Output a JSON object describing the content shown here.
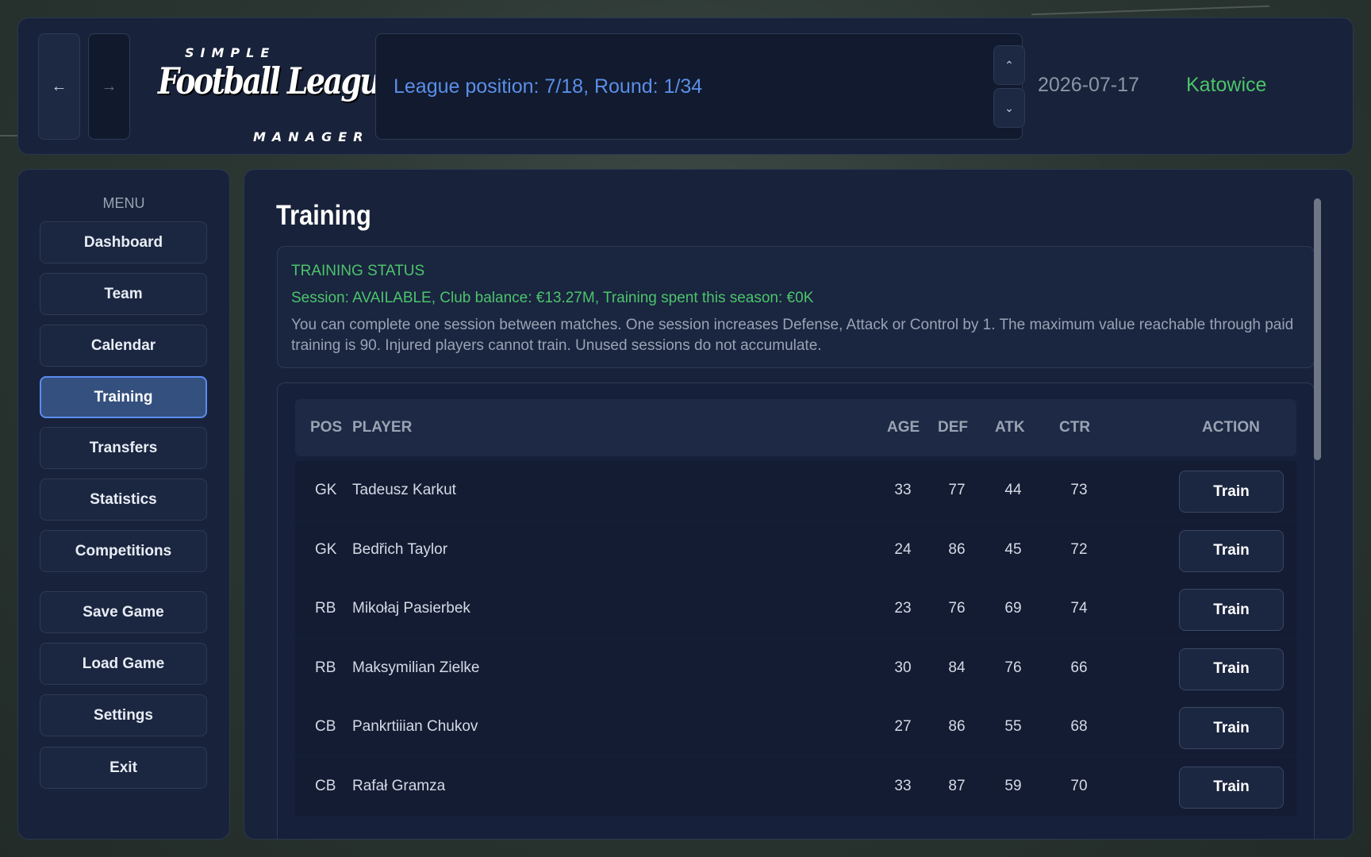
{
  "header": {
    "back_icon": "←",
    "forward_icon": "→",
    "logo": {
      "line1": "SIMPLE",
      "line2": "Football League",
      "line3": "MANAGER"
    },
    "league_status": "League position: 7/18, Round: 1/34",
    "up_icon": "⌃",
    "down_icon": "⌄",
    "date": "2026-07-17",
    "city": "Katowice"
  },
  "sidebar": {
    "title": "MENU",
    "items": [
      {
        "label": "Dashboard"
      },
      {
        "label": "Team"
      },
      {
        "label": "Calendar"
      },
      {
        "label": "Training",
        "active": true
      },
      {
        "label": "Transfers"
      },
      {
        "label": "Statistics"
      },
      {
        "label": "Competitions"
      },
      {
        "label": "Save Game"
      },
      {
        "label": "Load Game"
      },
      {
        "label": "Settings"
      },
      {
        "label": "Exit"
      }
    ]
  },
  "main": {
    "title": "Training",
    "status": {
      "heading": "TRAINING STATUS",
      "line": "Session: AVAILABLE, Club balance: €13.27M, Training spent this season: €0K",
      "description": "You can complete one session between matches. One session increases Defense, Attack or Control by 1. The maximum value reachable through paid training is 90. Injured players cannot train. Unused sessions do not accumulate."
    },
    "table": {
      "headers": {
        "pos": "POS",
        "player": "PLAYER",
        "age": "AGE",
        "def": "DEF",
        "atk": "ATK",
        "ctr": "CTR",
        "action": "ACTION"
      },
      "rows": [
        {
          "pos": "GK",
          "player": "Tadeusz Karkut",
          "age": "33",
          "def": "77",
          "atk": "44",
          "ctr": "73",
          "action": "Train"
        },
        {
          "pos": "GK",
          "player": "Bedřich Taylor",
          "age": "24",
          "def": "86",
          "atk": "45",
          "ctr": "72",
          "action": "Train"
        },
        {
          "pos": "RB",
          "player": "Mikołaj Pasierbek",
          "age": "23",
          "def": "76",
          "atk": "69",
          "ctr": "74",
          "action": "Train"
        },
        {
          "pos": "RB",
          "player": "Maksymilian Zielke",
          "age": "30",
          "def": "84",
          "atk": "76",
          "ctr": "66",
          "action": "Train"
        },
        {
          "pos": "CB",
          "player": "Pankrtiiian Chukov",
          "age": "27",
          "def": "86",
          "atk": "55",
          "ctr": "68",
          "action": "Train"
        },
        {
          "pos": "CB",
          "player": "Rafał Gramza",
          "age": "33",
          "def": "87",
          "atk": "59",
          "ctr": "70",
          "action": "Train"
        }
      ]
    }
  },
  "colors": {
    "accent_blue": "#5b8fe8",
    "accent_green": "#4cc46a",
    "panel": "#18223a",
    "active_button": "#34507e"
  }
}
